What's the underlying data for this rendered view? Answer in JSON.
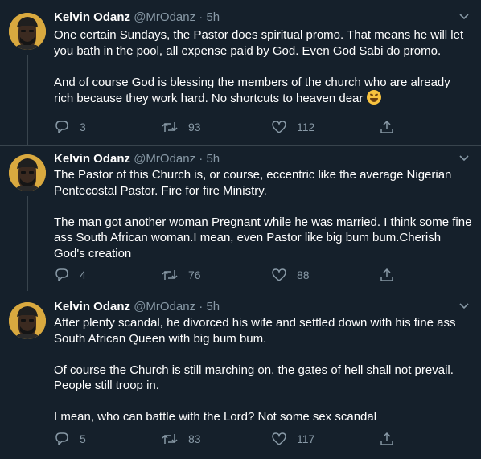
{
  "tweets": [
    {
      "name": "Kelvin Odanz",
      "handle": "@MrOdanz",
      "dot": "·",
      "time": "5h",
      "paragraphs": [
        "One certain Sundays, the Pastor does spiritual promo. That means he will let you bath in the pool, all expense paid by God. Even God Sabi do promo.",
        "And of course God is blessing the members of the church who are already rich because they work hard. No shortcuts to heaven dear"
      ],
      "emoji": "rolling-on-floor-laughing-emoji",
      "replies": "3",
      "retweets": "93",
      "likes": "112"
    },
    {
      "name": "Kelvin Odanz",
      "handle": "@MrOdanz",
      "dot": "·",
      "time": "5h",
      "paragraphs": [
        "The Pastor of this Church is, or course, eccentric like the average Nigerian Pentecostal Pastor. Fire for fire Ministry.",
        "The man got another woman Pregnant while he was married. I think some fine ass South African woman.I mean, even Pastor like big bum bum.Cherish God's creation"
      ],
      "replies": "4",
      "retweets": "76",
      "likes": "88"
    },
    {
      "name": "Kelvin Odanz",
      "handle": "@MrOdanz",
      "dot": "·",
      "time": "5h",
      "paragraphs": [
        "After plenty scandal, he divorced his wife and settled down with his fine ass South African Queen with big bum bum.",
        "Of course the Church is still marching on, the gates of hell shall not prevail. People still troop in.",
        "I mean, who can battle with the Lord? Not some sex scandal"
      ],
      "replies": "5",
      "retweets": "83",
      "likes": "117"
    }
  ],
  "colors": {
    "background": "#15202b",
    "text": "#ffffff",
    "muted": "#8899a6",
    "divider": "#38444d",
    "avatar": "#d9a93f"
  },
  "icons": [
    "reply-icon",
    "retweet-icon",
    "like-icon",
    "share-icon",
    "chevron-down-icon"
  ]
}
